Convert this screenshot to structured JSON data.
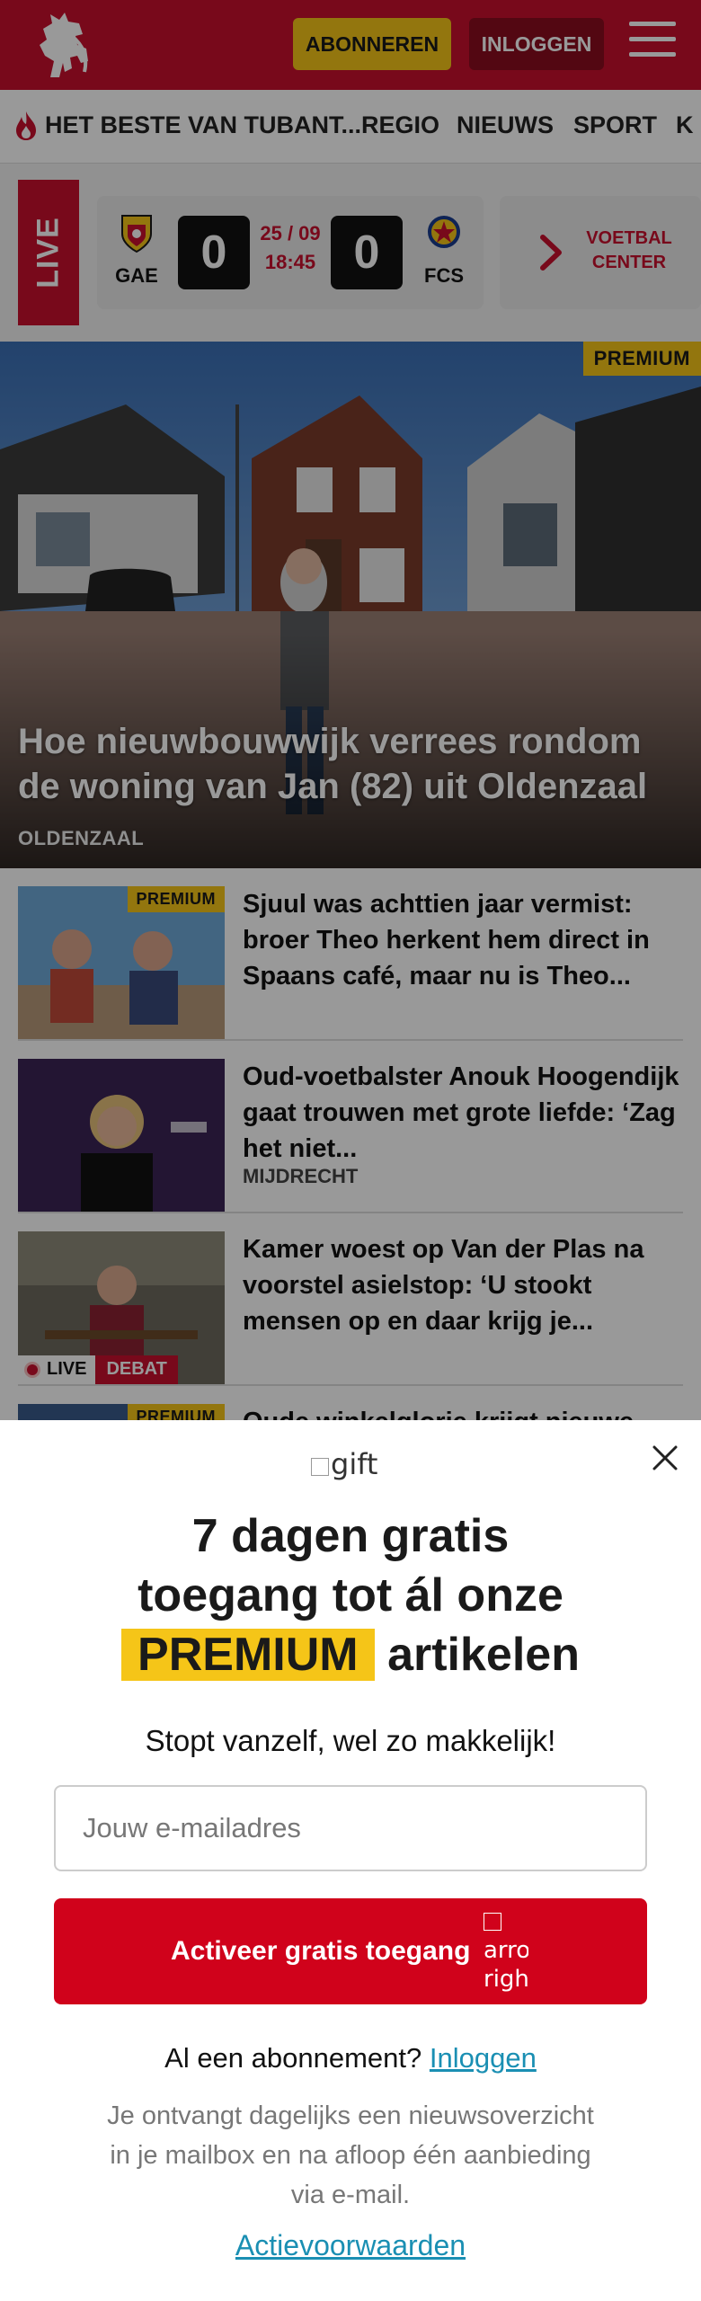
{
  "header": {
    "subscribe_label": "ABONNEREN",
    "login_label": "INLOGGEN",
    "brand_color": "#c8102e",
    "accent_color": "#f5c518"
  },
  "nav": {
    "items": [
      "HET BESTE VAN TUBANT...",
      "REGIO",
      "NIEUWS",
      "SPORT",
      "K"
    ]
  },
  "live": {
    "label": "LIVE",
    "match": {
      "home": "GAE",
      "away": "FCS",
      "home_score": "0",
      "away_score": "0",
      "date": "25 / 09",
      "time": "18:45"
    },
    "center_label_1": "VOETBAL",
    "center_label_2": "CENTER"
  },
  "hero": {
    "badge": "PREMIUM",
    "title": "Hoe nieuwbouwwijk verrees rondom de woning van Jan (82) uit Oldenzaal",
    "kicker": "OLDENZAAL"
  },
  "articles": [
    {
      "badge": "PREMIUM",
      "title": "Sjuul was achttien jaar vermist: broer Theo herkent hem direct in Spaans café, maar nu is Theo...",
      "kicker": ""
    },
    {
      "badge": "",
      "title": "Oud-voetbalster Anouk Hoogendijk gaat trouwen met grote liefde: ‘Zag het niet...",
      "kicker": "MIJDRECHT"
    },
    {
      "badge": "",
      "title": "Kamer woest op Van der Plas na voorstel asielstop: ‘U stookt mensen op en daar krijg je...",
      "kicker": "",
      "live_label": "LIVE",
      "tag": "DEBAT"
    },
    {
      "badge": "PREMIUM",
      "title": "Oude winkelglorie krijgt nieuwe",
      "kicker": ""
    }
  ],
  "modal": {
    "gift_alt": "gift",
    "headline_1": "7 dagen gratis",
    "headline_2": "toegang tot ál onze",
    "headline_premium": "PREMIUM",
    "headline_3": "artikelen",
    "subline": "Stopt vanzelf, wel zo makkelijk!",
    "email_placeholder": "Jouw e-mailadres",
    "cta_label": "Activeer gratis toegang",
    "cta_icon_alt": "arrow-right",
    "have_sub": "Al een abonnement?",
    "login_link": "Inloggen",
    "note": "Je ontvangt dagelijks een nieuwsoverzicht in je mailbox en na afloop één aanbieding via e-mail.",
    "terms": "Actievoorwaarden"
  }
}
